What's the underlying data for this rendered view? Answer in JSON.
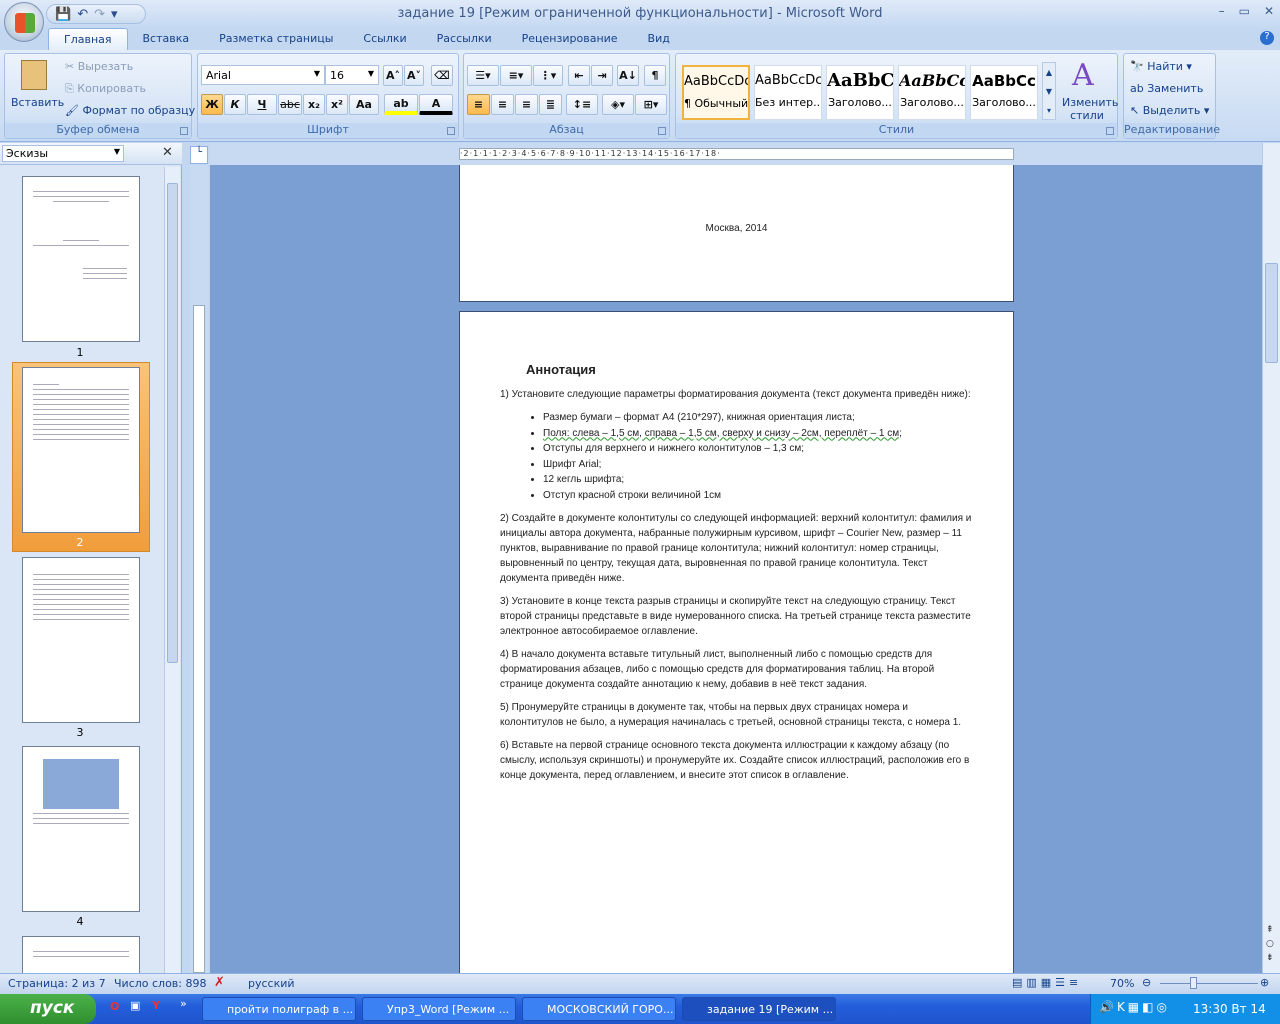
{
  "window": {
    "title": "задание 19 [Режим ограниченной функциональности] - Microsoft Word",
    "controls": [
      "–",
      "▭",
      "✕"
    ]
  },
  "qat": {
    "icons": [
      "save-icon",
      "undo-icon",
      "redo-icon",
      "customize-icon"
    ]
  },
  "tabs": [
    "Главная",
    "Вставка",
    "Разметка страницы",
    "Ссылки",
    "Рассылки",
    "Рецензирование",
    "Вид"
  ],
  "clipboard": {
    "paste": "Вставить",
    "cut": "Вырезать",
    "copy": "Копировать",
    "format_painter": "Формат по образцу",
    "label": "Буфер обмена"
  },
  "font": {
    "name": "Arial",
    "size": "16",
    "bold": "Ж",
    "italic": "К",
    "underline": "Ч",
    "strike": "abc",
    "sub": "x₂",
    "sup": "x²",
    "case": "Aa",
    "grow": "A˄",
    "shrink": "A˅",
    "label": "Шрифт"
  },
  "paragraph": {
    "label": "Абзац",
    "pilcrow": "¶"
  },
  "styles": {
    "label": "Стили",
    "items": [
      {
        "preview": "AaBbCcDc",
        "name": "¶ Обычный"
      },
      {
        "preview": "AaBbCcDc",
        "name": "Без интер..."
      },
      {
        "preview": "AaBbC",
        "name": "Заголово..."
      },
      {
        "preview": "AaBbCc",
        "name": "Заголово..."
      },
      {
        "preview": "AaBbCc",
        "name": "Заголово..."
      }
    ],
    "change": "Изменить стили"
  },
  "editing": {
    "label": "Редактирование",
    "find": "Найти",
    "replace": "Заменить",
    "select": "Выделить"
  },
  "thumbnails": {
    "title": "Эскизы",
    "pages": [
      "1",
      "2",
      "3",
      "4"
    ]
  },
  "ruler": {
    "h": "·2·1·1·1·2·3·4·5·6·7·8·9·10·11·12·13·14·15·16·17·18·"
  },
  "document": {
    "page1_footer": "Москва, 2014",
    "heading": "Аннотация",
    "p1": "1) Установите следующие параметры форматирования документа (текст документа приведён ниже):",
    "bullets": [
      "Размер бумаги – формат А4 (210*297), книжная ориентация листа;",
      "Поля: слева – 1,5 см, справа – 1,5 см, сверху и снизу – 2см, переплёт – 1 см;",
      "Отступы для верхнего и нижнего колонтитулов – 1,3 см;",
      "Шрифт Arial;",
      "12 кегль шрифта;",
      "Отступ красной строки величиной 1см"
    ],
    "p2": "2) Создайте в документе колонтитулы со следующей информацией: верхний колонтитул: фамилия и инициалы автора документа, набранные полужирным курсивом, шрифт – Courier New, размер – 11 пунктов, выравнивание по правой границе колонтитула; нижний колонтитул: номер страницы, выровненный по центру, текущая дата, выровненная по правой границе колонтитула. Текст документа приведён ниже.",
    "p3": "3) Установите в конце текста разрыв страницы и скопируйте текст на следующую страницу. Текст второй страницы представьте в виде нумерованного списка. На третьей странице текста разместите электронное автособираемое оглавление.",
    "p4": "4) В начало документа вставьте титульный лист, выполненный либо с помощью средств для форматирования абзацев, либо с помощью средств для форматирования таблиц. На второй странице документа создайте аннотацию к нему, добавив в неё текст задания.",
    "p5": "5) Пронумеруйте страницы в документе так, чтобы на первых двух страницах номера и колонтитулов не было, а нумерация начиналась с третьей, основной страницы текста, с номера 1.",
    "p6": "6) Вставьте на первой странице основного текста документа иллюстрации к каждому абзацу (по смыслу, используя скриншоты) и пронумеруйте их. Создайте список иллюстраций, расположив его в конце документа, перед оглавлением, и внесите этот список в оглавление."
  },
  "status": {
    "page": "Страница: 2 из 7",
    "words": "Число слов: 898",
    "language": "русский",
    "zoom": "70%",
    "zoom_value": 70
  },
  "taskbar": {
    "start": "пуск",
    "tasks": [
      "пройти полиграф в ...",
      "Упр3_Word [Режим ...",
      "МОСКОВСКИЙ ГОРО...",
      "задание 19 [Режим ..."
    ],
    "clock": "13:30 Вт 14"
  }
}
